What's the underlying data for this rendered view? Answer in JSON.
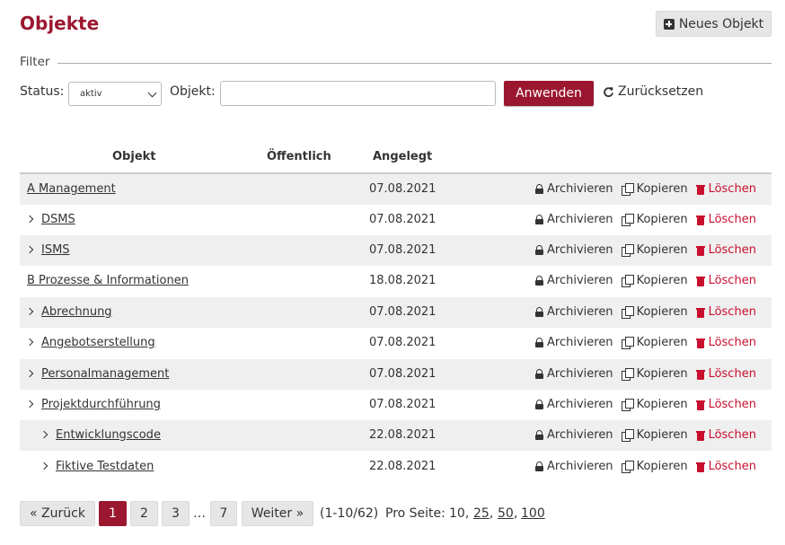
{
  "title": "Objekte",
  "new_button": "Neues Objekt",
  "filter": {
    "legend": "Filter",
    "status_label": "Status:",
    "status_value": "aktiv",
    "objekt_label": "Objekt:",
    "objekt_value": "",
    "apply_label": "Anwenden",
    "reset_label": "Zurücksetzen"
  },
  "table": {
    "headers": [
      "Objekt",
      "Öffentlich",
      "Angelegt"
    ],
    "rows": [
      {
        "name": "A Management",
        "date": "07.08.2021"
      },
      {
        "name": "DSMS",
        "date": "07.08.2021"
      },
      {
        "name": "ISMS",
        "date": "07.08.2021"
      },
      {
        "name": "B Prozesse & Informationen",
        "date": "18.08.2021"
      },
      {
        "name": "Abrechnung",
        "date": "07.08.2021"
      },
      {
        "name": "Angebotserstellung",
        "date": "07.08.2021"
      },
      {
        "name": "Personalmanagement",
        "date": "07.08.2021"
      },
      {
        "name": "Projektdurchführung",
        "date": "07.08.2021"
      },
      {
        "name": "Entwicklungscode",
        "date": "22.08.2021"
      },
      {
        "name": "Fiktive Testdaten",
        "date": "22.08.2021"
      }
    ],
    "actions": {
      "archive": "Archivieren",
      "copy": "Kopieren",
      "delete": "Löschen"
    }
  },
  "pagination": {
    "prev": "« Zurück",
    "pages": [
      "1",
      "2",
      "3"
    ],
    "ellipsis": "…",
    "last": "7",
    "next": "Weiter »",
    "range": "(1-10/62)",
    "per_page_label": "Pro Seite:",
    "per_page_current": "10,",
    "per_page_options": [
      "25",
      "50",
      "100"
    ]
  },
  "colors": {
    "brand": "#9b1730",
    "delete": "#c8102e"
  }
}
